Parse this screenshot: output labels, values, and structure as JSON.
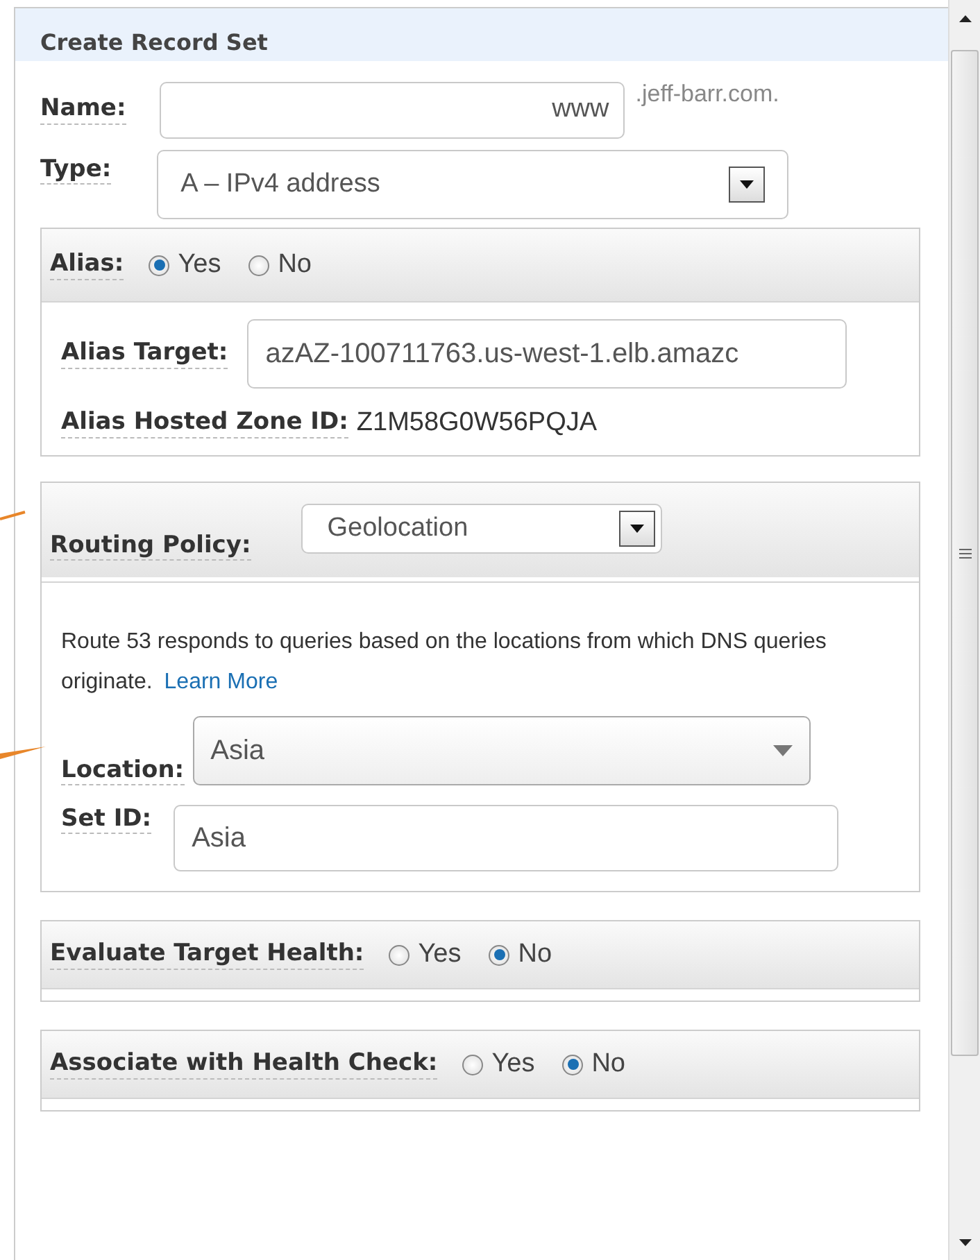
{
  "title": "Create Record Set",
  "name": {
    "label": "Name:",
    "value": "www",
    "suffix": ".jeff-barr.com."
  },
  "type": {
    "label": "Type:",
    "value": "A – IPv4 address"
  },
  "alias": {
    "label": "Alias:",
    "options": [
      {
        "label": "Yes",
        "selected": true
      },
      {
        "label": "No",
        "selected": false
      }
    ],
    "target_label": "Alias Target:",
    "target_value": "azAZ-100711763.us-west-1.elb.amazc",
    "zone_label": "Alias Hosted Zone ID:",
    "zone_value": "Z1M58G0W56PQJA"
  },
  "routing": {
    "label": "Routing Policy:",
    "value": "Geolocation",
    "description": "Route 53 responds to queries based on the locations from which DNS queries originate.",
    "link": "Learn More",
    "location_label": "Location:",
    "location_value": "Asia",
    "set_id_label": "Set ID:",
    "set_id_value": "Asia"
  },
  "evaluate_target_health": {
    "label": "Evaluate Target Health:",
    "options": [
      {
        "label": "Yes",
        "selected": false
      },
      {
        "label": "No",
        "selected": true
      }
    ]
  },
  "associate_health_check": {
    "label": "Associate with Health Check:",
    "options": [
      {
        "label": "Yes",
        "selected": false
      },
      {
        "label": "No",
        "selected": true
      }
    ]
  }
}
